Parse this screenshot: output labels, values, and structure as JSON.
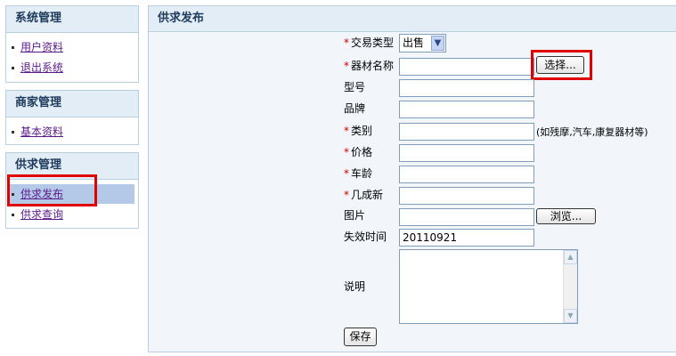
{
  "sidebar": {
    "sections": [
      {
        "title": "系统管理",
        "items": [
          "用户资料",
          "退出系统"
        ]
      },
      {
        "title": "商家管理",
        "items": [
          "基本资料"
        ]
      },
      {
        "title": "供求管理",
        "items": [
          "供求发布",
          "供求查询"
        ]
      }
    ],
    "active_item": "供求发布"
  },
  "main": {
    "title": "供求发布",
    "form": {
      "trade_type_label": "交易类型",
      "trade_type_value": "出售",
      "equipment_name_label": "器材名称",
      "select_button": "选择...",
      "model_label": "型号",
      "brand_label": "品牌",
      "category_label": "类别",
      "category_hint": "(如残摩,汽车,康复器材等)",
      "price_label": "价格",
      "vehicle_age_label": "车龄",
      "condition_label": "几成新",
      "image_label": "图片",
      "browse_button": "浏览...",
      "expiry_label": "失效时间",
      "expiry_value": "20110921",
      "description_label": "说明",
      "save_button": "保存",
      "required_mark": "*"
    }
  },
  "colors": {
    "highlight": "#e00000",
    "required": "#cc0000",
    "header_bg": "#e3edf6",
    "active_nav": "#b4c8e8",
    "link": "#5a1b8a"
  }
}
